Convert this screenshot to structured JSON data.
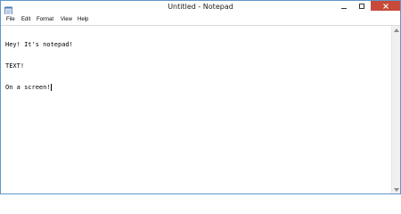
{
  "window": {
    "title": "Untitled - Notepad",
    "accent_border": "#5f98c9",
    "close_button_color": "#c74a3a"
  },
  "titlebar": {
    "app_icon": "notepad-icon",
    "buttons": [
      "minimize-icon",
      "maximize-icon",
      "close-icon"
    ]
  },
  "menu": {
    "items": [
      {
        "label": "File"
      },
      {
        "label": "Edit"
      },
      {
        "label": "Format"
      },
      {
        "label": "View"
      },
      {
        "label": "Help"
      }
    ]
  },
  "editor": {
    "lines": [
      "Hey! It's notepad!",
      "TEXT!",
      "On a screen!"
    ]
  },
  "scrollbar": {
    "up_icon": "scroll-up-arrow-icon",
    "down_icon": "scroll-down-arrow-icon"
  }
}
